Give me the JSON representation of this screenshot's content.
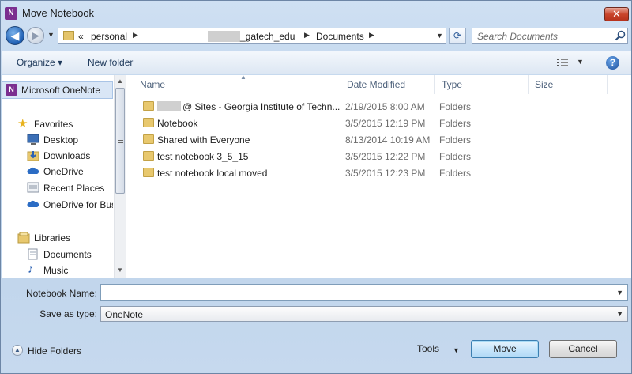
{
  "window": {
    "title": "Move Notebook",
    "app_icon_text": "N",
    "close_glyph": "✕"
  },
  "address": {
    "overflow": "«",
    "crumbs": [
      "personal",
      "_gatech_edu",
      "Documents"
    ],
    "search_placeholder": "Search Documents"
  },
  "toolbar": {
    "organize": "Organize ▾",
    "new_folder": "New folder",
    "help": "?"
  },
  "nav": {
    "selected": "Microsoft OneNote",
    "items": [
      {
        "label": "Favorites",
        "icon": "star-icon"
      },
      {
        "label": "Desktop",
        "icon": "desktop-icon"
      },
      {
        "label": "Downloads",
        "icon": "downloads-icon"
      },
      {
        "label": "OneDrive",
        "icon": "onedrive-icon"
      },
      {
        "label": "Recent Places",
        "icon": "recent-places-icon"
      },
      {
        "label": "OneDrive for Bus",
        "icon": "onedrive-icon"
      },
      {
        "label": "Libraries",
        "icon": "libraries-icon"
      },
      {
        "label": "Documents",
        "icon": "documents-icon"
      },
      {
        "label": "Music",
        "icon": "music-icon"
      }
    ]
  },
  "columns": {
    "name": "Name",
    "date": "Date Modified",
    "type": "Type",
    "size": "Size"
  },
  "files": [
    {
      "name": "@ Sites - Georgia Institute of Techn...",
      "date": "2/19/2015 8:00 AM",
      "type": "Folders"
    },
    {
      "name": "Notebook",
      "date": "3/5/2015 12:19 PM",
      "type": "Folders"
    },
    {
      "name": "Shared with Everyone",
      "date": "8/13/2014 10:19 AM",
      "type": "Folders"
    },
    {
      "name": "test notebook 3_5_15",
      "date": "3/5/2015 12:22 PM",
      "type": "Folders"
    },
    {
      "name": "test notebook local moved",
      "date": "3/5/2015 12:23 PM",
      "type": "Folders"
    }
  ],
  "form": {
    "name_label": "Notebook Name:",
    "name_value": "",
    "type_label": "Save as type:",
    "type_value": "OneNote"
  },
  "footer": {
    "hide_folders": "Hide Folders",
    "tools": "Tools",
    "move": "Move",
    "cancel": "Cancel"
  },
  "colors": {
    "accent": "#1f5fb3",
    "onenote_purple": "#7b2e8f",
    "close_red": "#c9452c"
  }
}
